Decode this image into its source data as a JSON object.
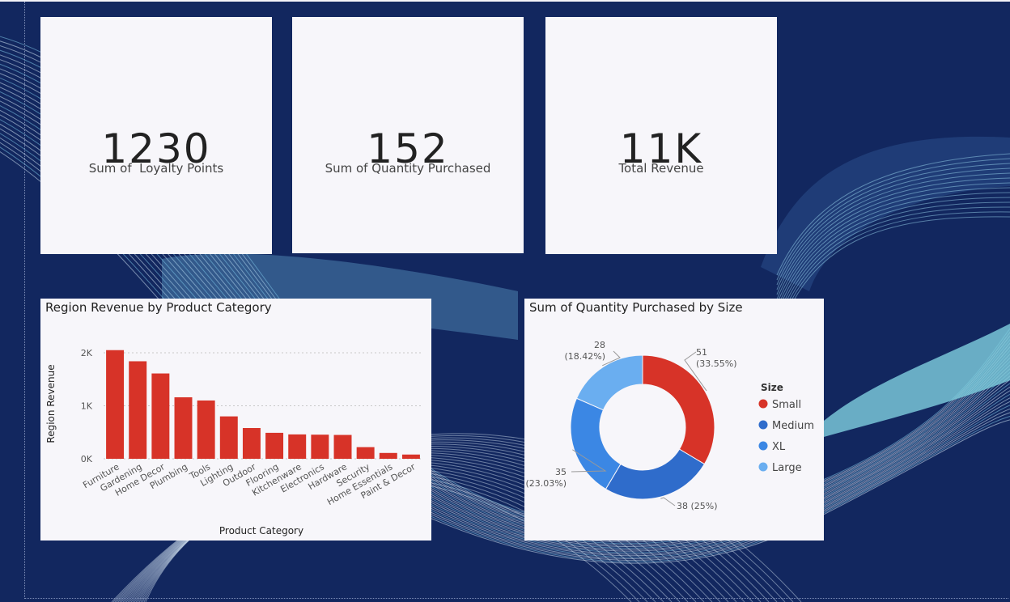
{
  "kpis": [
    {
      "value": "1230",
      "label": "Sum of  Loyalty Points"
    },
    {
      "value": "152",
      "label": "Sum of Quantity Purchased"
    },
    {
      "value": "11K",
      "label": "Total Revenue"
    }
  ],
  "colors": {
    "background": "#12275f",
    "card": "#f7f6fa",
    "bar": "#d73328",
    "small": "#d73328",
    "medium": "#2f6ccb",
    "xl": "#3b87e4",
    "large": "#6aaef0"
  },
  "chart_data": [
    {
      "type": "bar",
      "title": "Region Revenue by Product Category",
      "xlabel": "Product Category",
      "ylabel": "Region Revenue",
      "categories": [
        "Furniture",
        "Gardening",
        "Home Decor",
        "Plumbing",
        "Tools",
        "Lighting",
        "Outdoor",
        "Flooring",
        "Kitchenware",
        "Electronics",
        "Hardware",
        "Security",
        "Home Essentials",
        "Paint & Decor"
      ],
      "values": [
        2050,
        1840,
        1610,
        1160,
        1100,
        800,
        580,
        490,
        460,
        455,
        450,
        220,
        110,
        80
      ],
      "ylim": [
        0,
        2000
      ],
      "yticks": [
        "0K",
        "1K",
        "2K"
      ],
      "grid": true
    },
    {
      "type": "pie",
      "title": "Sum of Quantity Purchased by Size",
      "legend_title": "Size",
      "legend_position": "right",
      "categories": [
        "Small",
        "Medium",
        "XL",
        "Large"
      ],
      "values": [
        51,
        38,
        35,
        28
      ],
      "labels": [
        [
          "51",
          "(33.55%)"
        ],
        [
          "38 (25%)"
        ],
        [
          "35",
          "(23.03%)"
        ],
        [
          "28",
          "(18.42%)"
        ]
      ]
    }
  ]
}
